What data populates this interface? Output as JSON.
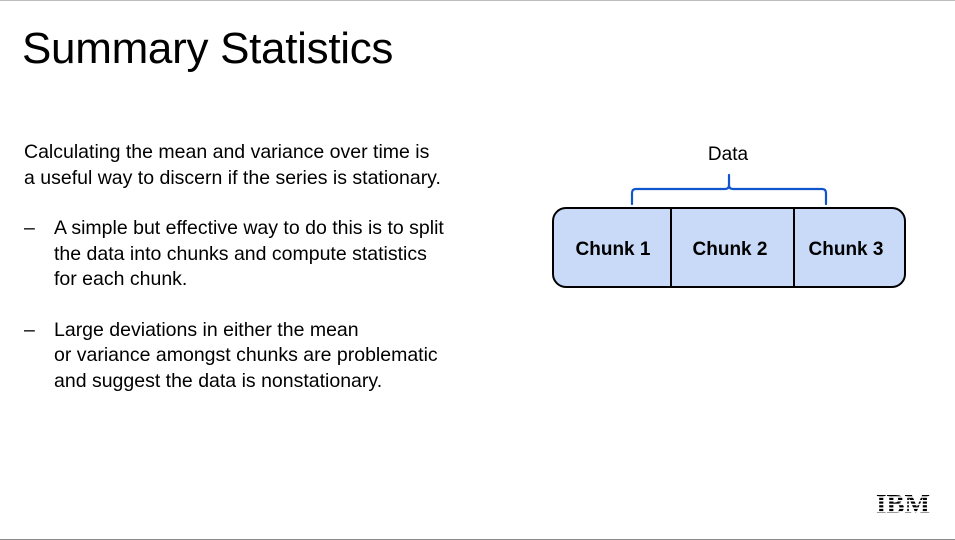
{
  "slide": {
    "title": "Summary Statistics",
    "intro_lines": [
      "Calculating the mean and variance over time is",
      "a useful way to discern if the series is stationary."
    ],
    "bullet_marker": "–",
    "bullets": [
      {
        "lines": [
          "A simple but effective way to do this is to split",
          "the data into chunks and compute statistics",
          "for each chunk."
        ]
      },
      {
        "lines": [
          "Large deviations in either the mean",
          "or variance amongst chunks are problematic",
          "and suggest the data is nonstationary."
        ]
      }
    ]
  },
  "diagram": {
    "brace_label": "Data",
    "chunks": [
      "Chunk 1",
      "Chunk 2",
      "Chunk 3"
    ],
    "colors": {
      "chunk_fill": "#c9daf8",
      "chunk_border": "#000000",
      "brace": "#1155cc"
    }
  },
  "logo": {
    "name": "ibm-logo",
    "text": "IBM"
  }
}
